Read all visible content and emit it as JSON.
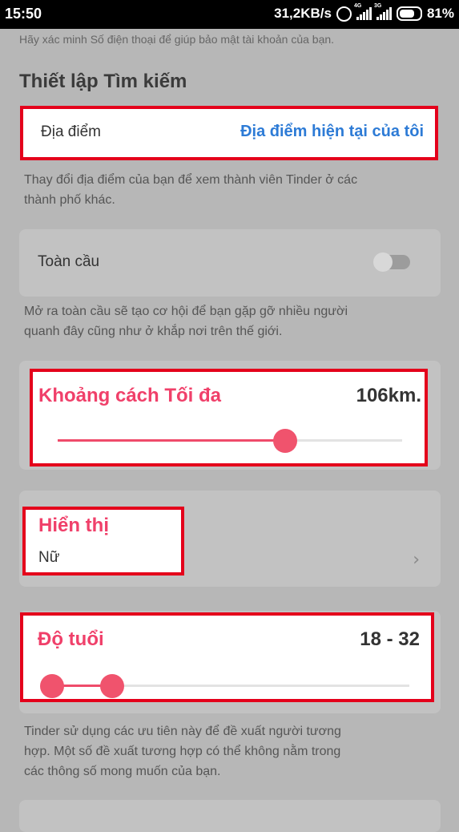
{
  "status": {
    "time": "15:50",
    "net_speed": "31,2KB/s",
    "net1": "4G",
    "net2": "3G",
    "battery": "81%"
  },
  "top_hint": "Hãy xác minh Số điện thoại để giúp bảo mật tài khoản của bạn.",
  "section_title": "Thiết lập Tìm kiếm",
  "location": {
    "label": "Địa điểm",
    "value": "Địa điểm hiện tại của tôi",
    "hint_line1": "Thay đổi địa điểm của bạn để xem thành viên Tinder ở các",
    "hint_line2": "thành phố khác."
  },
  "global": {
    "label": "Toàn cầu",
    "enabled": false,
    "hint_line1": "Mở ra toàn cầu sẽ tạo cơ hội để bạn gặp gỡ nhiều người",
    "hint_line2": "quanh đây cũng như ở khắp nơi trên thế giới."
  },
  "max_distance": {
    "label": "Khoảng cách Tối đa",
    "value": "106km.",
    "slider_fraction": 0.66
  },
  "show": {
    "label": "Hiển thị",
    "value": "Nữ"
  },
  "age": {
    "label": "Độ tuổi",
    "value": "18 - 32",
    "min": 18,
    "max": 32
  },
  "bottom_hint": {
    "line1": "Tinder sử dụng các ưu tiên này để đề xuất người tương",
    "line2": "hợp. Một số đề xuất tương hợp có thể không nằm trong",
    "line3": "các thông số mong muốn của bạn."
  },
  "icons": [
    "alarm-icon",
    "signal-icon",
    "battery-icon",
    "chevron-right-icon"
  ],
  "colors": {
    "accent_pink": "#f0406a",
    "link_blue": "#2d7bd6",
    "highlight_red": "#e4001b"
  }
}
